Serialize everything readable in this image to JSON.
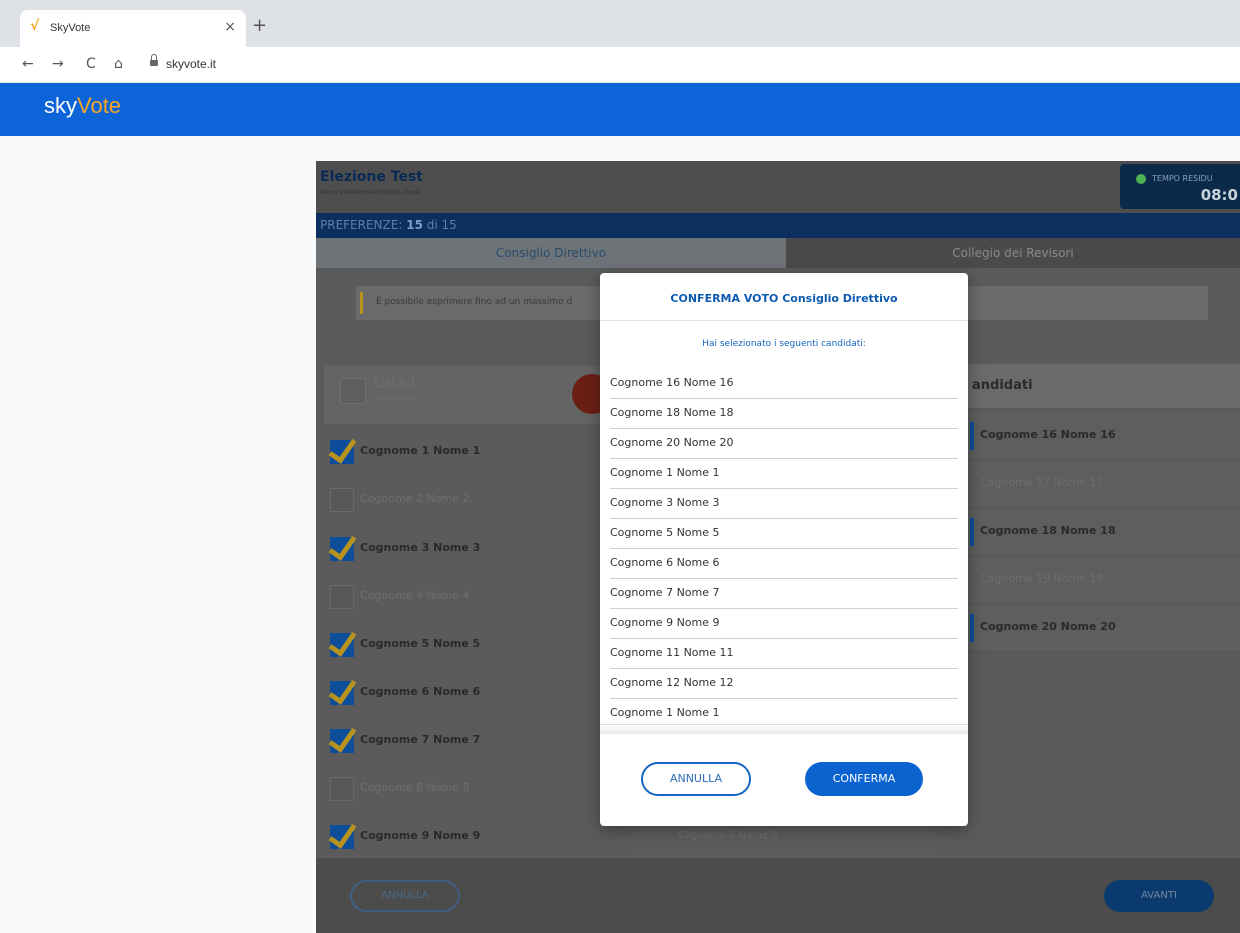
{
  "browser": {
    "tab_title": "SkyVote",
    "favicon": "√",
    "close": "×",
    "new_tab": "+",
    "url": "skyvote.it",
    "back": "←",
    "forward": "→",
    "reload": "C",
    "home": "⌂"
  },
  "header": {
    "logo_a": "sky",
    "logo_b": "Vote",
    "brand_color": "#0d64d8",
    "accent_color": "#f5a623"
  },
  "election": {
    "title": "Elezione Test",
    "subtitle": "Demo piattaforma SkyVote Cloud",
    "timer_label": "TEMPO RESIDU",
    "timer_value": "08:0",
    "preferences_label": "PREFERENZE:",
    "preferences_count": "15",
    "preferences_of": "di 15",
    "tabs": [
      "Consiglio Direttivo",
      "Collegio dei Revisori"
    ],
    "notice": "È possibile esprimere fino ad un massimo d",
    "list_title": "Lista 1",
    "list_subtitle": "Nome Lista",
    "left_candidates": [
      {
        "name": "Cognome 1 Nome 1",
        "selected": true
      },
      {
        "name": "Cognome 2 Nome 2",
        "selected": false
      },
      {
        "name": "Cognome 3 Nome 3",
        "selected": true
      },
      {
        "name": "Cognome 4 Nome 4",
        "selected": false
      },
      {
        "name": "Cognome 5 Nome 5",
        "selected": true
      },
      {
        "name": "Cognome 6 Nome 6",
        "selected": true
      },
      {
        "name": "Cognome 7 Nome 7",
        "selected": true
      },
      {
        "name": "Cognome 8 Nome 8",
        "selected": false
      },
      {
        "name": "Cognome 9 Nome 9",
        "selected": true
      }
    ],
    "right_header": "andidati",
    "right_candidates": [
      {
        "name": "Cognome 16 Nome 16",
        "selected": true
      },
      {
        "name": "Cognome 17 Nome 17",
        "selected": false
      },
      {
        "name": "Cognome 18 Nome 18",
        "selected": true
      },
      {
        "name": "Cognome 19 Nome 19",
        "selected": false
      },
      {
        "name": "Cognome 20 Nome 20",
        "selected": true
      }
    ],
    "middle_hint": "Cognome 8 Nome 8",
    "footer_cancel": "ANNULLA",
    "footer_next": "AVANTI"
  },
  "modal": {
    "title": "CONFERMA VOTO Consiglio Direttivo",
    "intro": "Hai selezionato i seguenti candidati:",
    "selected": [
      "Cognome 16 Nome 16",
      "Cognome 18 Nome 18",
      "Cognome 20 Nome 20",
      "Cognome 1 Nome 1",
      "Cognome 3 Nome 3",
      "Cognome 5 Nome 5",
      "Cognome 6 Nome 6",
      "Cognome 7 Nome 7",
      "Cognome 9 Nome 9",
      "Cognome 11 Nome 11",
      "Cognome 12 Nome 12",
      "Cognome 1 Nome 1"
    ],
    "cancel_label": "ANNULLA",
    "confirm_label": "CONFERMA"
  }
}
